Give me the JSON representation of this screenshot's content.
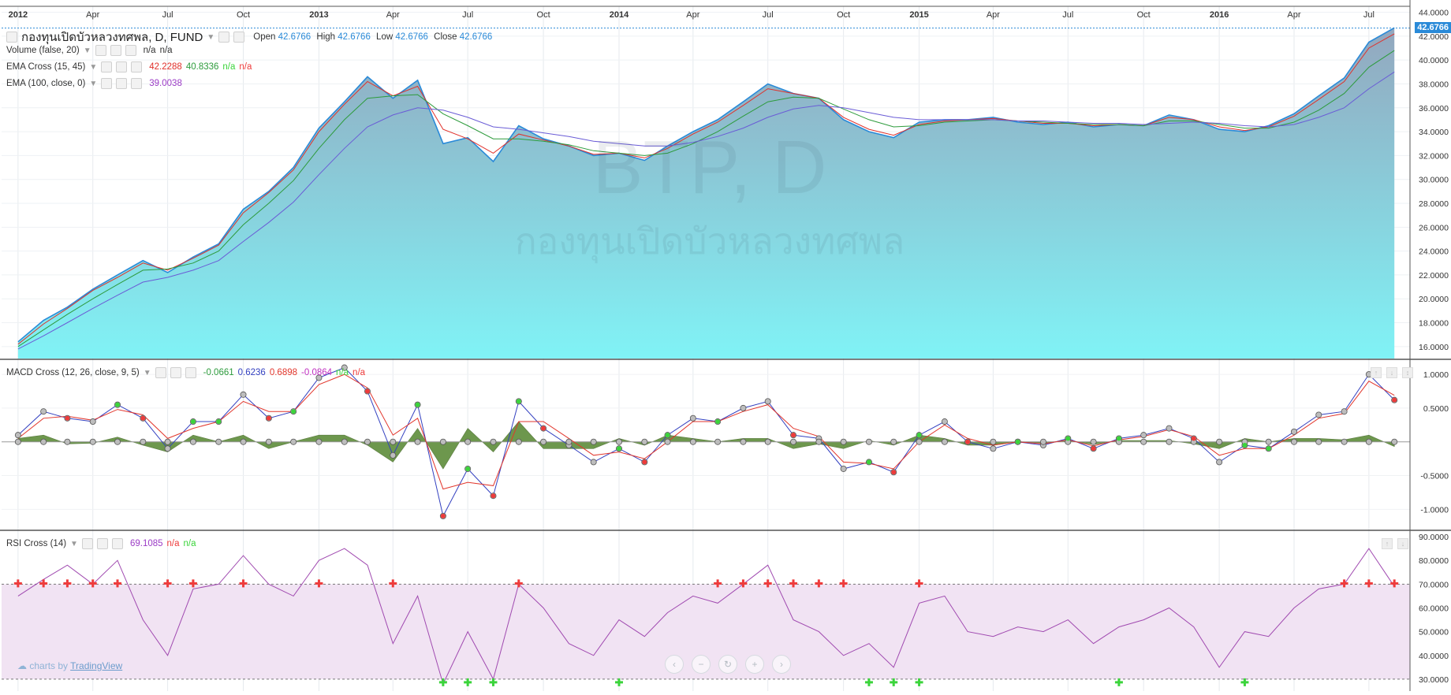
{
  "symbol": {
    "title": "กองทุนเปิดบัวหลวงทศพล, D, FUND",
    "ohlc": [
      {
        "label": "Open",
        "value": "42.6766"
      },
      {
        "label": "High",
        "value": "42.6766"
      },
      {
        "label": "Low",
        "value": "42.6766"
      },
      {
        "label": "Close",
        "value": "42.6766"
      }
    ],
    "last_price": "42.6766",
    "watermark_ticker": "BTP, D",
    "watermark_name": "กองทุนเปิดบัวหลวงทศพล"
  },
  "indicators": {
    "volume": {
      "label": "Volume (false, 20)",
      "v1": "n/a",
      "v2": "n/a"
    },
    "ema_cross": {
      "label": "EMA Cross (15, 45)",
      "v1": "42.2288",
      "v2": "40.8336",
      "v3": "n/a",
      "v4": "n/a"
    },
    "ema": {
      "label": "EMA (100, close, 0)",
      "v1": "39.0038"
    },
    "macd": {
      "label": "MACD Cross (12, 26, close, 9, 5)",
      "v1": "-0.0661",
      "v2": "0.6236",
      "v3": "0.6898",
      "v4": "-0.0864",
      "v5": "n/a",
      "v6": "n/a"
    },
    "rsi": {
      "label": "RSI Cross (14)",
      "v1": "69.1085",
      "v2": "n/a",
      "v3": "n/a"
    }
  },
  "colors": {
    "price_line": "#2a8ad8",
    "area_top": "#93a7be",
    "area_bottom": "#80f3f6",
    "ema_fast": "#e0302a",
    "ema_slow": "#2d9b3c",
    "ema100": "#6a5cd6",
    "macd_line": "#3340c0",
    "signal_line": "#e2362c",
    "histogram": "#5e8c3a",
    "rsi_line": "#a04ab0",
    "rsi_band": "#f1e3f3",
    "cross_red": "#ee3b3b",
    "cross_green": "#3bd43b"
  },
  "time_axis": {
    "labels": [
      "2012",
      "Apr",
      "Jul",
      "Oct",
      "2013",
      "Apr",
      "Jul",
      "Oct",
      "2014",
      "Apr",
      "Jul",
      "Oct",
      "2015",
      "Apr",
      "Jul",
      "Oct",
      "2016",
      "Apr",
      "Jul"
    ]
  },
  "branding": {
    "prefix": "charts by",
    "name": "TradingView"
  },
  "nav_icons": [
    "chevron-left-icon",
    "zoom-out-icon",
    "reset-icon",
    "zoom-in-icon",
    "chevron-right-icon"
  ],
  "chart_data": [
    {
      "type": "area",
      "title": "กองทุนเปิดบัวหลวงทศพล, D, FUND",
      "ylim": [
        15.0,
        44.5
      ],
      "yticks": [
        16,
        18,
        20,
        22,
        24,
        26,
        28,
        30,
        32,
        34,
        36,
        38,
        40,
        42,
        44
      ],
      "ytick_labels": [
        "16.0000",
        "18.0000",
        "20.0000",
        "22.0000",
        "24.0000",
        "26.0000",
        "28.0000",
        "30.0000",
        "32.0000",
        "34.0000",
        "36.0000",
        "38.0000",
        "40.0000",
        "42.0000",
        "44.0000"
      ],
      "x": [
        "2012-01-01",
        "2012-02-01",
        "2012-03-01",
        "2012-04-01",
        "2012-05-01",
        "2012-06-01",
        "2012-07-01",
        "2012-08-01",
        "2012-09-01",
        "2012-10-01",
        "2012-11-01",
        "2012-12-01",
        "2013-01-01",
        "2013-02-01",
        "2013-03-01",
        "2013-04-01",
        "2013-05-01",
        "2013-06-01",
        "2013-07-01",
        "2013-08-01",
        "2013-09-01",
        "2013-10-01",
        "2013-11-01",
        "2013-12-01",
        "2014-01-01",
        "2014-02-01",
        "2014-03-01",
        "2014-04-01",
        "2014-05-01",
        "2014-06-01",
        "2014-07-01",
        "2014-08-01",
        "2014-09-01",
        "2014-10-01",
        "2014-11-01",
        "2014-12-01",
        "2015-01-01",
        "2015-02-01",
        "2015-03-01",
        "2015-04-01",
        "2015-05-01",
        "2015-06-01",
        "2015-07-01",
        "2015-08-01",
        "2015-09-01",
        "2015-10-01",
        "2015-11-01",
        "2015-12-01",
        "2016-01-01",
        "2016-02-01",
        "2016-03-01",
        "2016-04-01",
        "2016-05-01",
        "2016-06-01",
        "2016-07-01",
        "2016-08-01"
      ],
      "series": [
        {
          "name": "Close",
          "values": [
            16.4,
            18.2,
            19.3,
            20.8,
            22.0,
            23.2,
            22.2,
            23.5,
            24.6,
            27.5,
            29.0,
            31.0,
            34.3,
            36.5,
            38.6,
            36.8,
            38.3,
            33.0,
            33.5,
            31.5,
            34.5,
            33.4,
            32.8,
            32.0,
            32.2,
            31.6,
            32.8,
            34.0,
            35.0,
            36.5,
            38.0,
            37.2,
            36.8,
            35.0,
            34.0,
            33.5,
            34.8,
            35.0,
            35.0,
            35.2,
            34.8,
            34.6,
            34.8,
            34.4,
            34.6,
            34.5,
            35.4,
            35.0,
            34.2,
            34.0,
            34.5,
            35.5,
            37.0,
            38.5,
            41.5,
            42.7
          ]
        },
        {
          "name": "EMA Cross 15",
          "values": [
            16.2,
            17.9,
            19.2,
            20.7,
            21.8,
            23.0,
            22.4,
            23.4,
            24.5,
            27.2,
            28.9,
            30.8,
            34.0,
            36.3,
            38.2,
            37.0,
            37.8,
            34.2,
            33.4,
            32.2,
            33.8,
            33.3,
            32.8,
            32.1,
            32.2,
            31.8,
            32.6,
            33.8,
            34.8,
            36.2,
            37.6,
            37.2,
            36.8,
            35.2,
            34.2,
            33.7,
            34.6,
            34.9,
            35.0,
            35.1,
            34.9,
            34.7,
            34.7,
            34.5,
            34.6,
            34.5,
            35.2,
            35.0,
            34.4,
            34.1,
            34.4,
            35.3,
            36.7,
            38.2,
            41.0,
            42.2
          ]
        },
        {
          "name": "EMA Cross 45",
          "values": [
            16.0,
            17.4,
            18.7,
            20.0,
            21.2,
            22.4,
            22.5,
            23.0,
            24.0,
            26.2,
            28.0,
            29.9,
            32.6,
            35.0,
            36.8,
            37.0,
            37.1,
            35.5,
            34.5,
            33.4,
            33.4,
            33.2,
            32.9,
            32.4,
            32.2,
            32.0,
            32.2,
            33.0,
            34.0,
            35.3,
            36.5,
            36.9,
            36.8,
            35.9,
            35.0,
            34.4,
            34.5,
            34.8,
            34.9,
            35.0,
            34.9,
            34.8,
            34.7,
            34.6,
            34.6,
            34.5,
            34.9,
            34.9,
            34.6,
            34.3,
            34.3,
            34.8,
            35.8,
            37.2,
            39.4,
            40.8
          ]
        },
        {
          "name": "EMA 100",
          "values": [
            15.8,
            16.9,
            18.0,
            19.2,
            20.3,
            21.4,
            21.8,
            22.4,
            23.2,
            24.8,
            26.4,
            28.1,
            30.4,
            32.6,
            34.4,
            35.4,
            36.0,
            35.8,
            35.2,
            34.4,
            34.2,
            33.9,
            33.6,
            33.2,
            33.0,
            32.8,
            32.8,
            33.1,
            33.6,
            34.3,
            35.2,
            35.9,
            36.2,
            36.0,
            35.6,
            35.2,
            35.0,
            35.0,
            35.0,
            35.0,
            34.9,
            34.9,
            34.8,
            34.7,
            34.7,
            34.6,
            34.7,
            34.8,
            34.7,
            34.5,
            34.4,
            34.6,
            35.2,
            36.0,
            37.6,
            39.0
          ]
        }
      ]
    },
    {
      "type": "line",
      "title": "MACD Cross (12, 26, close, 9, 5)",
      "ylim": [
        -1.3,
        1.2
      ],
      "yticks": [
        -1.0,
        -0.5,
        0.5,
        1.0
      ],
      "ytick_labels": [
        "-1.0000",
        "-0.5000",
        "0.5000",
        "1.0000"
      ],
      "x": [
        "2012-01-01",
        "2012-02-01",
        "2012-03-01",
        "2012-04-01",
        "2012-05-01",
        "2012-06-01",
        "2012-07-01",
        "2012-08-01",
        "2012-09-01",
        "2012-10-01",
        "2012-11-01",
        "2012-12-01",
        "2013-01-01",
        "2013-02-01",
        "2013-03-01",
        "2013-04-01",
        "2013-05-01",
        "2013-06-01",
        "2013-07-01",
        "2013-08-01",
        "2013-09-01",
        "2013-10-01",
        "2013-11-01",
        "2013-12-01",
        "2014-01-01",
        "2014-02-01",
        "2014-03-01",
        "2014-04-01",
        "2014-05-01",
        "2014-06-01",
        "2014-07-01",
        "2014-08-01",
        "2014-09-01",
        "2014-10-01",
        "2014-11-01",
        "2014-12-01",
        "2015-01-01",
        "2015-02-01",
        "2015-03-01",
        "2015-04-01",
        "2015-05-01",
        "2015-06-01",
        "2015-07-01",
        "2015-08-01",
        "2015-09-01",
        "2015-10-01",
        "2015-11-01",
        "2015-12-01",
        "2016-01-01",
        "2016-02-01",
        "2016-03-01",
        "2016-04-01",
        "2016-05-01",
        "2016-06-01",
        "2016-07-01",
        "2016-08-01"
      ],
      "series": [
        {
          "name": "MACD",
          "values": [
            0.1,
            0.45,
            0.35,
            0.3,
            0.55,
            0.35,
            -0.1,
            0.3,
            0.3,
            0.7,
            0.35,
            0.45,
            0.95,
            1.1,
            0.75,
            -0.2,
            0.55,
            -1.1,
            -0.4,
            -0.8,
            0.6,
            0.2,
            -0.05,
            -0.3,
            -0.1,
            -0.3,
            0.1,
            0.35,
            0.3,
            0.5,
            0.6,
            0.1,
            0.05,
            -0.4,
            -0.3,
            -0.45,
            0.1,
            0.3,
            0.0,
            -0.1,
            0.0,
            -0.05,
            0.05,
            -0.1,
            0.05,
            0.1,
            0.2,
            0.05,
            -0.3,
            -0.05,
            -0.1,
            0.15,
            0.4,
            0.45,
            1.0,
            0.62
          ]
        },
        {
          "name": "Signal",
          "values": [
            0.05,
            0.35,
            0.38,
            0.32,
            0.48,
            0.4,
            0.05,
            0.2,
            0.3,
            0.6,
            0.45,
            0.45,
            0.85,
            1.0,
            0.8,
            0.1,
            0.35,
            -0.7,
            -0.6,
            -0.65,
            0.3,
            0.3,
            0.05,
            -0.2,
            -0.15,
            -0.25,
            0.0,
            0.3,
            0.3,
            0.45,
            0.55,
            0.2,
            0.08,
            -0.3,
            -0.32,
            -0.4,
            0.0,
            0.25,
            0.05,
            -0.05,
            0.0,
            -0.03,
            0.03,
            -0.06,
            0.03,
            0.08,
            0.18,
            0.08,
            -0.2,
            -0.1,
            -0.1,
            0.1,
            0.35,
            0.42,
            0.9,
            0.69
          ]
        },
        {
          "name": "Histogram",
          "values": [
            0.05,
            0.1,
            -0.03,
            -0.02,
            0.07,
            -0.05,
            -0.15,
            0.1,
            0.0,
            0.1,
            -0.1,
            0.0,
            0.1,
            0.1,
            -0.05,
            -0.3,
            0.2,
            -0.4,
            0.2,
            -0.15,
            0.3,
            -0.1,
            -0.1,
            -0.1,
            0.05,
            -0.05,
            0.1,
            0.05,
            0.0,
            0.05,
            0.05,
            -0.1,
            -0.03,
            -0.1,
            0.02,
            -0.05,
            0.1,
            0.05,
            -0.05,
            -0.05,
            0.0,
            -0.02,
            0.02,
            -0.04,
            0.02,
            0.02,
            0.02,
            -0.03,
            -0.1,
            0.05,
            0.0,
            0.05,
            0.05,
            0.03,
            0.1,
            -0.07
          ]
        }
      ]
    },
    {
      "type": "line",
      "title": "RSI Cross (14)",
      "ylim": [
        25,
        92
      ],
      "yticks": [
        30,
        40,
        50,
        60,
        70,
        80,
        90
      ],
      "ytick_labels": [
        "30.0000",
        "40.0000",
        "50.0000",
        "60.0000",
        "70.0000",
        "80.0000",
        "90.0000"
      ],
      "band": [
        30,
        70
      ],
      "x": [
        "2012-01-01",
        "2012-02-01",
        "2012-03-01",
        "2012-04-01",
        "2012-05-01",
        "2012-06-01",
        "2012-07-01",
        "2012-08-01",
        "2012-09-01",
        "2012-10-01",
        "2012-11-01",
        "2012-12-01",
        "2013-01-01",
        "2013-02-01",
        "2013-03-01",
        "2013-04-01",
        "2013-05-01",
        "2013-06-01",
        "2013-07-01",
        "2013-08-01",
        "2013-09-01",
        "2013-10-01",
        "2013-11-01",
        "2013-12-01",
        "2014-01-01",
        "2014-02-01",
        "2014-03-01",
        "2014-04-01",
        "2014-05-01",
        "2014-06-01",
        "2014-07-01",
        "2014-08-01",
        "2014-09-01",
        "2014-10-01",
        "2014-11-01",
        "2014-12-01",
        "2015-01-01",
        "2015-02-01",
        "2015-03-01",
        "2015-04-01",
        "2015-05-01",
        "2015-06-01",
        "2015-07-01",
        "2015-08-01",
        "2015-09-01",
        "2015-10-01",
        "2015-11-01",
        "2015-12-01",
        "2016-01-01",
        "2016-02-01",
        "2016-03-01",
        "2016-04-01",
        "2016-05-01",
        "2016-06-01",
        "2016-07-01",
        "2016-08-01"
      ],
      "series": [
        {
          "name": "RSI",
          "values": [
            65,
            72,
            78,
            70,
            80,
            55,
            40,
            68,
            70,
            82,
            70,
            65,
            80,
            85,
            78,
            45,
            65,
            28,
            50,
            30,
            70,
            60,
            45,
            40,
            55,
            48,
            58,
            65,
            62,
            70,
            78,
            55,
            50,
            40,
            45,
            35,
            62,
            65,
            50,
            48,
            52,
            50,
            55,
            45,
            52,
            55,
            60,
            52,
            35,
            50,
            48,
            60,
            68,
            70,
            85,
            69
          ]
        }
      ],
      "cross_up_markers": [
        "2012-01-01",
        "2012-02-01",
        "2012-03-01",
        "2012-04-01",
        "2012-05-01",
        "2012-07-01",
        "2012-08-01",
        "2012-10-01",
        "2013-01-01",
        "2013-04-01",
        "2013-09-01",
        "2014-05-01",
        "2014-06-01",
        "2014-07-01",
        "2014-08-01",
        "2014-09-01",
        "2014-10-01",
        "2015-01-01",
        "2016-06-01",
        "2016-07-01",
        "2016-08-01"
      ],
      "cross_down_markers": [
        "2013-06-01",
        "2013-07-01",
        "2013-08-01",
        "2014-01-01",
        "2014-11-01",
        "2014-12-01",
        "2015-01-01",
        "2015-09-01",
        "2016-02-01"
      ]
    }
  ]
}
